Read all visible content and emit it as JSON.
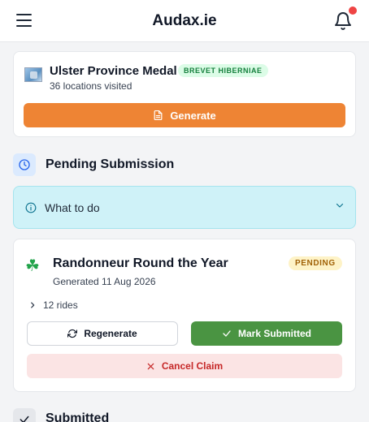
{
  "header": {
    "title": "Audax.ie"
  },
  "medal": {
    "title": "Ulster Province Medal",
    "badge": "BREVET HIBERNIAE",
    "subtitle": "36 locations visited",
    "button_label": "Generate"
  },
  "pending_section": {
    "title": "Pending Submission"
  },
  "what_to_do": {
    "label": "What to do"
  },
  "claim": {
    "title": "Randonneur Round the Year",
    "status": "PENDING",
    "generated": "Generated 11 Aug 2026",
    "rides": "12 rides",
    "regenerate_label": "Regenerate",
    "submit_label": "Mark Submitted",
    "cancel_label": "Cancel Claim"
  },
  "submitted_section": {
    "title": "Submitted"
  },
  "colors": {
    "accent_orange": "#ee8434",
    "success_green": "#4a9442",
    "danger_red": "#c62828",
    "info_cyan": "#cff2f8",
    "notification_dot": "#ef4444"
  },
  "icons": {
    "menu": "hamburger-icon",
    "bell": "bell-icon",
    "generate": "document-icon",
    "pending": "clock-icon",
    "info": "info-icon",
    "expand": "chevron-down-icon",
    "claim": "shamrock-icon",
    "rides": "chevron-right-icon",
    "regenerate": "refresh-icon",
    "submit": "check-icon",
    "cancel": "x-icon",
    "submitted": "check-icon"
  }
}
